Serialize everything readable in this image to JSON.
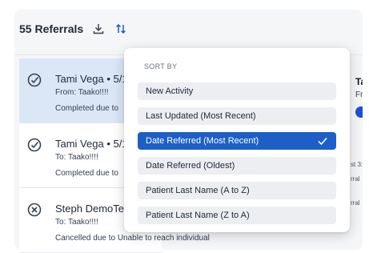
{
  "header": {
    "title": "55 Referrals",
    "download_icon": "download-icon",
    "sort_icon": "sort-arrows-icon"
  },
  "referrals": [
    {
      "name": "Tami Vega • 5/1",
      "direction": "From: Taako!!!!",
      "note": "Completed due to",
      "status_icon": "check-circle-icon",
      "selected": true
    },
    {
      "name": "Tami Vega • 5/1",
      "direction": "To: Taako!!!!",
      "note": "Completed due to",
      "status_icon": "check-circle-icon",
      "selected": false
    },
    {
      "name": "Steph DemoTes",
      "direction": "To: Taako!!!!",
      "note": "Cancelled due to Unable to reach individual",
      "status_icon": "x-circle-icon",
      "selected": false
    }
  ],
  "detail_peek": {
    "title": "Ta",
    "subtitle": "Fr",
    "snippet_1": "st 3:",
    "snippet_2": "rral",
    "snippet_3": "rral"
  },
  "sort_menu": {
    "heading": "SORT BY",
    "options": [
      {
        "label": "New Activity",
        "selected": false
      },
      {
        "label": "Last Updated (Most Recent)",
        "selected": false
      },
      {
        "label": "Date Referred (Most Recent)",
        "selected": true
      },
      {
        "label": "Date Referred (Oldest)",
        "selected": false
      },
      {
        "label": "Patient Last Name (A to Z)",
        "selected": false
      },
      {
        "label": "Patient Last Name (Z to A)",
        "selected": false
      }
    ],
    "selected_icon": "checkmark-icon"
  },
  "colors": {
    "accent": "#1d5fc7",
    "selected_card": "#dbe7f7",
    "option_bg": "#eceef1",
    "panel_bg": "#f5f6f8"
  }
}
